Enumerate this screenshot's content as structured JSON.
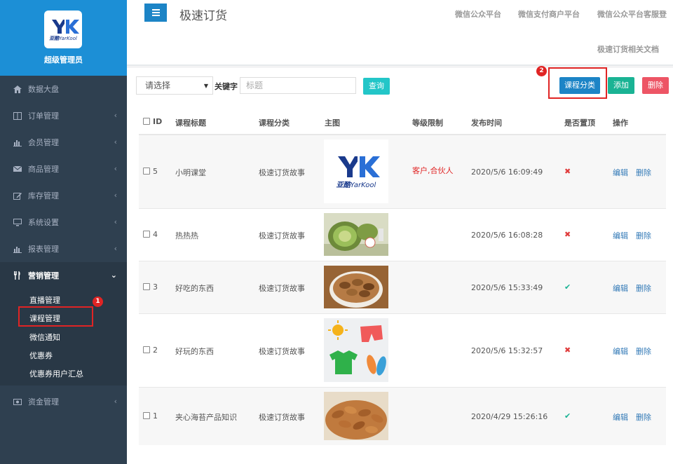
{
  "app": {
    "logo_cn": "亚酷",
    "logo_en": "YarKool",
    "role": "超级管理员",
    "page_title": "极速订货"
  },
  "top_links": [
    "微信公众平台",
    "微信支付商户平台",
    "微信公众平台客服登",
    "极速订货相关文档"
  ],
  "sidebar": {
    "items": [
      {
        "label": "数据大盘",
        "icon": "home-icon"
      },
      {
        "label": "订单管理",
        "icon": "columns-icon"
      },
      {
        "label": "会员管理",
        "icon": "bar-chart-icon"
      },
      {
        "label": "商品管理",
        "icon": "envelope-icon"
      },
      {
        "label": "库存管理",
        "icon": "edit-icon"
      },
      {
        "label": "系统设置",
        "icon": "monitor-icon"
      },
      {
        "label": "报表管理",
        "icon": "bar-chart-icon"
      },
      {
        "label": "营销管理",
        "icon": "cutlery-icon"
      },
      {
        "label": "资金管理",
        "icon": "money-icon"
      }
    ],
    "sub_items": [
      "直播管理",
      "课程管理",
      "微信通知",
      "优惠券",
      "优惠券用户汇总"
    ]
  },
  "annotations": [
    "1",
    "2"
  ],
  "filters": {
    "select_value": "请选择",
    "keyword_label": "关键字",
    "title_placeholder": "标题",
    "search_label": "查询"
  },
  "actions": {
    "category_label": "课程分类",
    "add_label": "添加",
    "delete_label": "删除"
  },
  "table": {
    "headers": [
      "ID",
      "课程标题",
      "课程分类",
      "主图",
      "等级限制",
      "发布时间",
      "是否置顶",
      "操作"
    ],
    "edit_label": "编辑",
    "delete_label": "删除",
    "rows": [
      {
        "id": "5",
        "title": "小明课堂",
        "category": "极速订货故事",
        "level": "客户,合伙人",
        "time": "2020/5/6 16:09:49",
        "pinned": false,
        "image": "logo"
      },
      {
        "id": "4",
        "title": "热热热",
        "category": "极速订货故事",
        "level": "",
        "time": "2020/5/6 16:08:28",
        "pinned": false,
        "image": "melon"
      },
      {
        "id": "3",
        "title": "好吃的东西",
        "category": "极速订货故事",
        "level": "",
        "time": "2020/5/6 15:33:49",
        "pinned": true,
        "image": "nuts-bowl"
      },
      {
        "id": "2",
        "title": "好玩的东西",
        "category": "极速订货故事",
        "level": "",
        "time": "2020/5/6 15:32:57",
        "pinned": false,
        "image": "summer-clothes"
      },
      {
        "id": "1",
        "title": "夹心海苔产品知识",
        "category": "极速订货故事",
        "level": "",
        "time": "2020/4/29 15:26:16",
        "pinned": true,
        "image": "almonds"
      }
    ]
  },
  "colors": {
    "sidebar_bg": "#2f4050",
    "profile_bg": "#1c8fd6",
    "primary": "#1c84c6",
    "info": "#23c6c8",
    "success": "#1ab394",
    "danger": "#ed5565",
    "highlight": "#e02424"
  }
}
